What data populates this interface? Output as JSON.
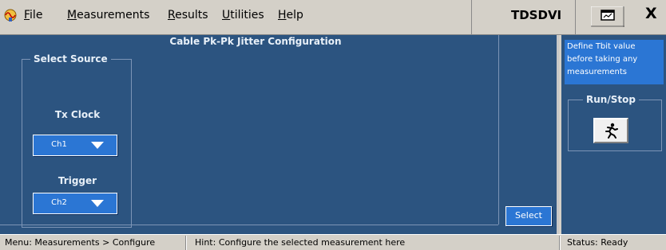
{
  "menubar": {
    "items": [
      {
        "label": "File"
      },
      {
        "label": "Measurements"
      },
      {
        "label": "Results"
      },
      {
        "label": "Utilities"
      },
      {
        "label": "Help"
      }
    ],
    "app_title": "TDSDVI",
    "close_glyph": "X"
  },
  "main": {
    "title": "Cable Pk-Pk Jitter Configuration",
    "source_group": {
      "legend": "Select Source",
      "tx_clock_label": "Tx Clock",
      "tx_clock_value": "Ch1",
      "trigger_label": "Trigger",
      "trigger_value": "Ch2"
    },
    "select_label": "Select"
  },
  "side": {
    "tbit_note": "Define Tbit value before taking any measurements",
    "runstop_legend": "Run/Stop"
  },
  "statusbar": {
    "menu_path": "Menu: Measurements > Configure",
    "hint": "Hint: Configure the selected measurement here",
    "status": "Status: Ready"
  },
  "icons": {
    "app": "oscilloscope-app-icon",
    "minimize": "minimize-window-icon",
    "runner": "running-man-icon",
    "dropdown_arrow": "triangle-down-icon"
  },
  "colors": {
    "panel_bg": "#2c5480",
    "button_bg": "#2b76d4",
    "chrome_bg": "#d4d0c8"
  }
}
